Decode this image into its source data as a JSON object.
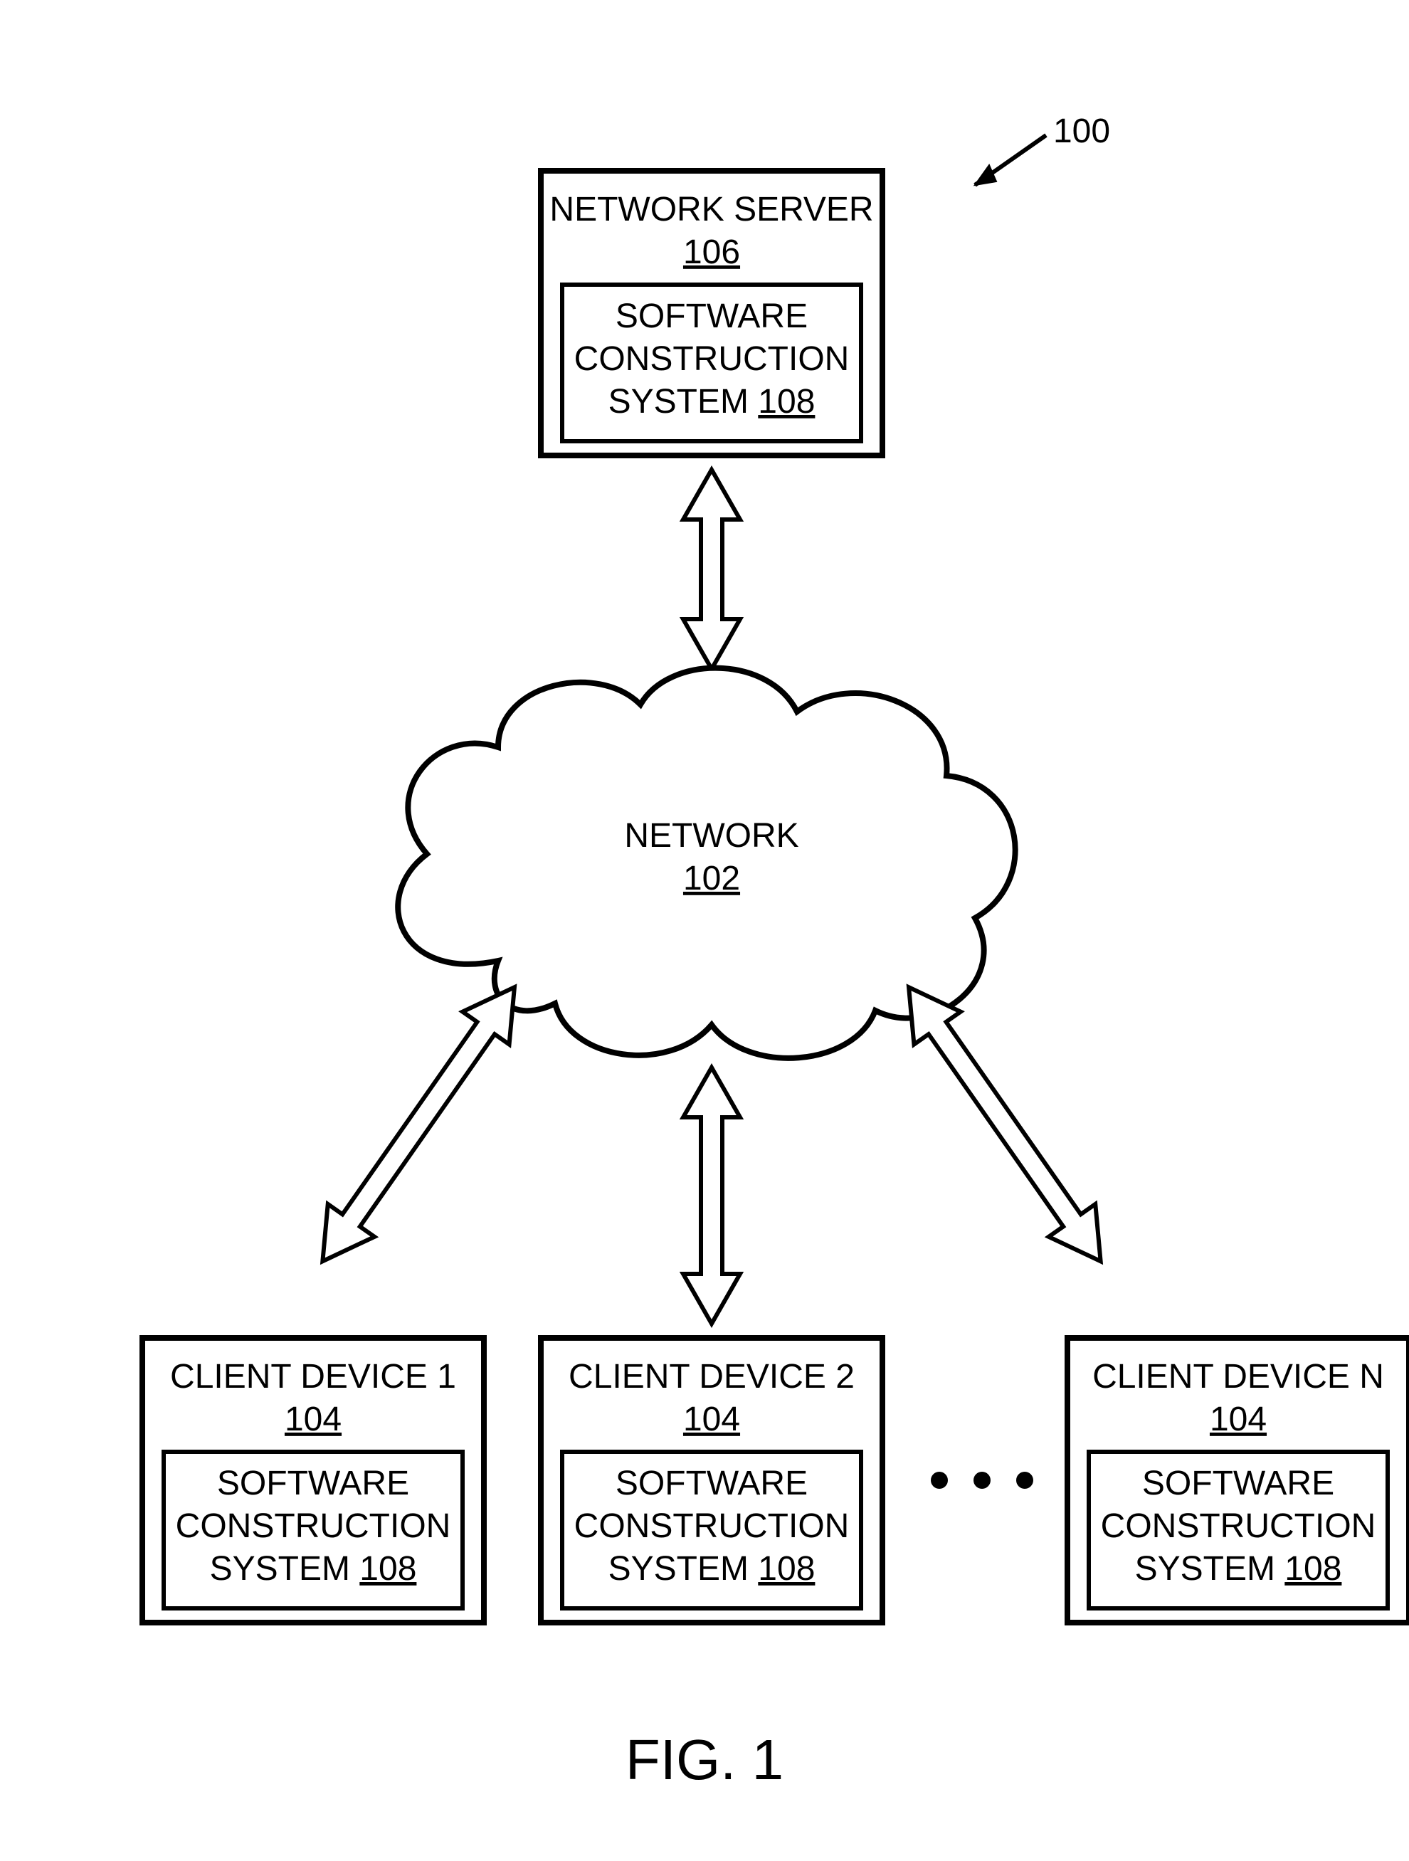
{
  "figure_ref": "100",
  "figure_label": "FIG. 1",
  "network": {
    "label": "NETWORK",
    "ref": "102"
  },
  "server": {
    "title": "NETWORK SERVER",
    "ref": "106",
    "inner": {
      "line1": "SOFTWARE",
      "line2": "CONSTRUCTION",
      "line3_prefix": "SYSTEM ",
      "line3_ref": "108"
    }
  },
  "clients": [
    {
      "title": "CLIENT DEVICE 1",
      "ref": "104",
      "inner": {
        "line1": "SOFTWARE",
        "line2": "CONSTRUCTION",
        "line3_prefix": "SYSTEM ",
        "line3_ref": "108"
      }
    },
    {
      "title": "CLIENT DEVICE 2",
      "ref": "104",
      "inner": {
        "line1": "SOFTWARE",
        "line2": "CONSTRUCTION",
        "line3_prefix": "SYSTEM ",
        "line3_ref": "108"
      }
    },
    {
      "title": "CLIENT DEVICE N",
      "ref": "104",
      "inner": {
        "line1": "SOFTWARE",
        "line2": "CONSTRUCTION",
        "line3_prefix": "SYSTEM ",
        "line3_ref": "108"
      }
    }
  ]
}
